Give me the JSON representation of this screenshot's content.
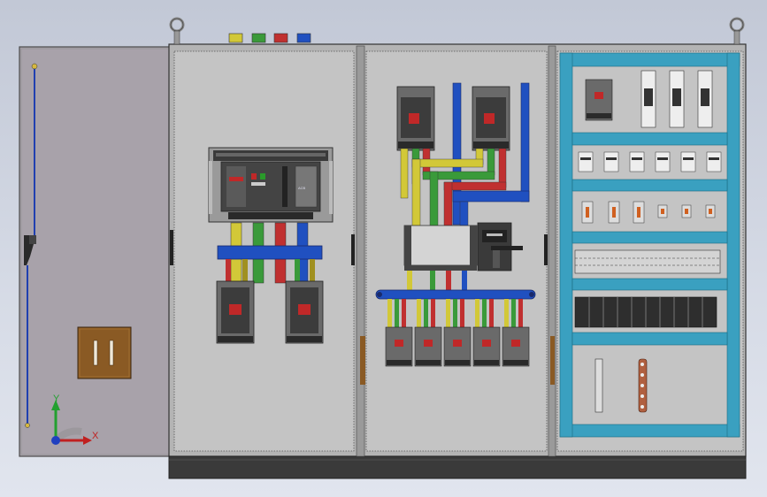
{
  "scene": {
    "axes": {
      "x_label": "X",
      "y_label": "Y"
    },
    "bus_colors": {
      "L1": "#d2c838",
      "L2": "#3a9a3a",
      "L3": "#c03030",
      "N": "#2050c0"
    },
    "panel_color": "#c8c8c8",
    "frame_color": "#3aa0c0",
    "handle_color": "#8a5a24"
  }
}
